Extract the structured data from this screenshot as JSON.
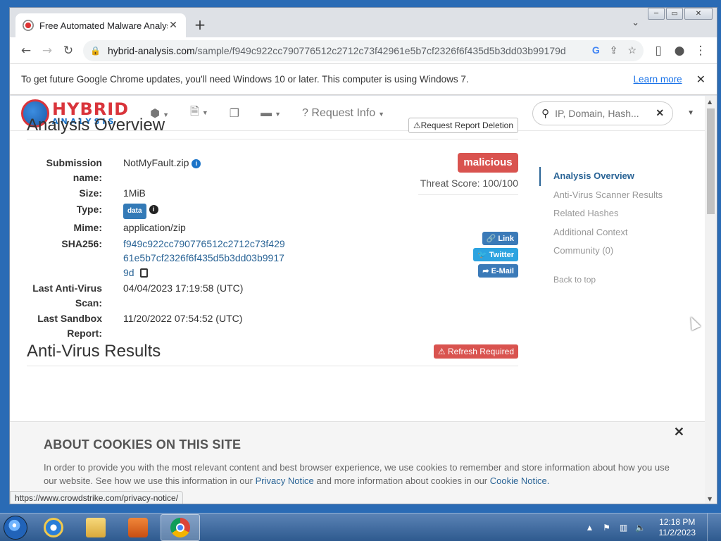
{
  "browser": {
    "tab_title": "Free Automated Malware Analysis Service - powered by Falcon Sandbox",
    "url_host": "hybrid-analysis.com",
    "url_path": "/sample/f949c922cc790776512c2712c73f42961e5b7cf2326f6f435d5b3dd03b99179d",
    "infobar_text": "To get future Google Chrome updates, you'll need Windows 10 or later. This computer is using Windows 7.",
    "infobar_link": "Learn more"
  },
  "site": {
    "logo_line1": "HYBRID",
    "logo_line2": "ANALYSIS",
    "nav_request_info": "Request Info",
    "search_placeholder": "IP, Domain, Hash..."
  },
  "overview": {
    "title": "Analysis Overview",
    "delete_button": "Request Report Deletion",
    "fields": {
      "submission_label": "Submission name:",
      "submission_value": "NotMyFault.zip",
      "size_label": "Size:",
      "size_value": "1MiB",
      "type_label": "Type:",
      "type_value": "data",
      "mime_label": "Mime:",
      "mime_value": "application/zip",
      "sha_label": "SHA256:",
      "sha_value": "f949c922cc790776512c2712c73f42961e5b7cf2326f6f435d5b3dd03b99179d",
      "av_scan_label": "Last Anti-Virus Scan:",
      "av_scan_value": "04/04/2023 17:19:58 (UTC)",
      "sandbox_label": "Last Sandbox Report:",
      "sandbox_value": "11/20/2022 07:54:52 (UTC)"
    },
    "verdict": "malicious",
    "threat_score": "Threat Score: 100/100",
    "share_link": "Link",
    "share_twitter": "Twitter",
    "share_email": "E-Mail"
  },
  "av_results": {
    "title": "Anti-Virus Results",
    "refresh_button": "Refresh Required"
  },
  "toc": {
    "items": [
      "Analysis Overview",
      "Anti-Virus Scanner Results",
      "Related Hashes",
      "Additional Context",
      "Community (0)"
    ],
    "back_to_top": "Back to top"
  },
  "cookie": {
    "title": "ABOUT COOKIES ON THIS SITE",
    "text_1": "In order to provide you with the most relevant content and best browser experience, we use cookies to remember and store information about how you use our website. See how we use this information in our",
    "privacy_link": "Privacy Notice",
    "text_2": "and more information about cookies in our",
    "cookie_link": "Cookie Notice."
  },
  "status_url": "https://www.crowdstrike.com/privacy-notice/",
  "taskbar": {
    "time": "12:18 PM",
    "date": "11/2/2023"
  },
  "colors": {
    "malicious": "#d9534f",
    "link": "#2a6496",
    "brand_red": "#d9343b",
    "brand_blue": "#1a73c8"
  }
}
